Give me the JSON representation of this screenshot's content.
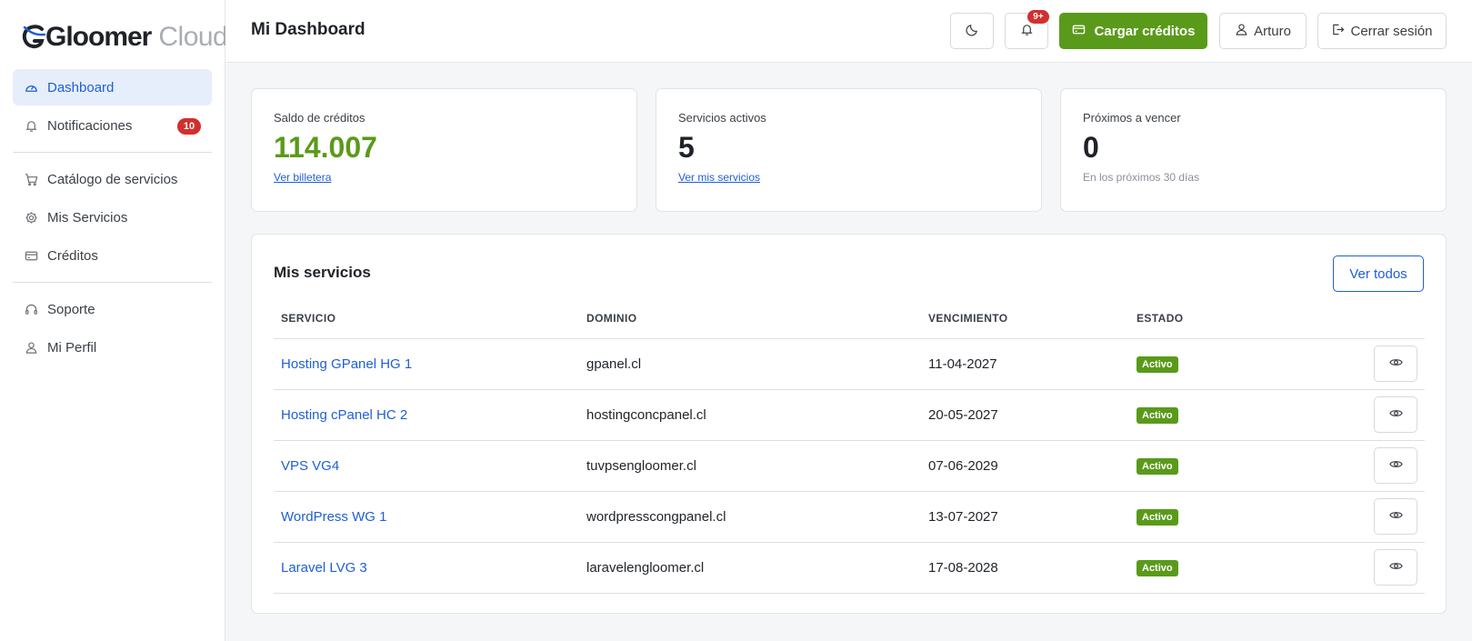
{
  "brand": {
    "name": "Gloomer",
    "suffix": "Cloud"
  },
  "sidebar": {
    "items": [
      {
        "label": "Dashboard",
        "icon": "gauge-icon",
        "active": true
      },
      {
        "label": "Notificaciones",
        "icon": "bell-icon",
        "badge": "10"
      },
      {
        "label": "Catálogo de servicios",
        "icon": "cart-icon"
      },
      {
        "label": "Mis Servicios",
        "icon": "gear-icon"
      },
      {
        "label": "Créditos",
        "icon": "credit-card-icon"
      },
      {
        "label": "Soporte",
        "icon": "headset-icon"
      },
      {
        "label": "Mi Perfil",
        "icon": "user-icon"
      }
    ]
  },
  "header": {
    "title": "Mi Dashboard",
    "notifications_badge": "9+",
    "load_credits_label": "Cargar créditos",
    "user_label": "Arturo",
    "logout_label": "Cerrar sesión"
  },
  "stats": [
    {
      "label": "Saldo de créditos",
      "value": "114.007",
      "link": "Ver billetera"
    },
    {
      "label": "Servicios activos",
      "value": "5",
      "link": "Ver mis servicios"
    },
    {
      "label": "Próximos a vencer",
      "value": "0",
      "note": "En los próximos 30 días"
    }
  ],
  "services": {
    "title": "Mis servicios",
    "view_all_label": "Ver todos",
    "columns": [
      "SERVICIO",
      "DOMINIO",
      "VENCIMIENTO",
      "ESTADO"
    ],
    "rows": [
      {
        "service": "Hosting GPanel HG 1",
        "domain": "gpanel.cl",
        "expires": "11-04-2027",
        "status": "Activo"
      },
      {
        "service": "Hosting cPanel HC 2",
        "domain": "hostingconcpanel.cl",
        "expires": "20-05-2027",
        "status": "Activo"
      },
      {
        "service": "VPS VG4",
        "domain": "tuvpsengloomer.cl",
        "expires": "07-06-2029",
        "status": "Activo"
      },
      {
        "service": "WordPress WG 1",
        "domain": "wordpresscongpanel.cl",
        "expires": "13-07-2027",
        "status": "Activo"
      },
      {
        "service": "Laravel LVG 3",
        "domain": "laravelengloomer.cl",
        "expires": "17-08-2028",
        "status": "Activo"
      }
    ]
  },
  "colors": {
    "accent": "#1f5fd6",
    "success": "#5a9a1a",
    "danger": "#d32f2f"
  }
}
